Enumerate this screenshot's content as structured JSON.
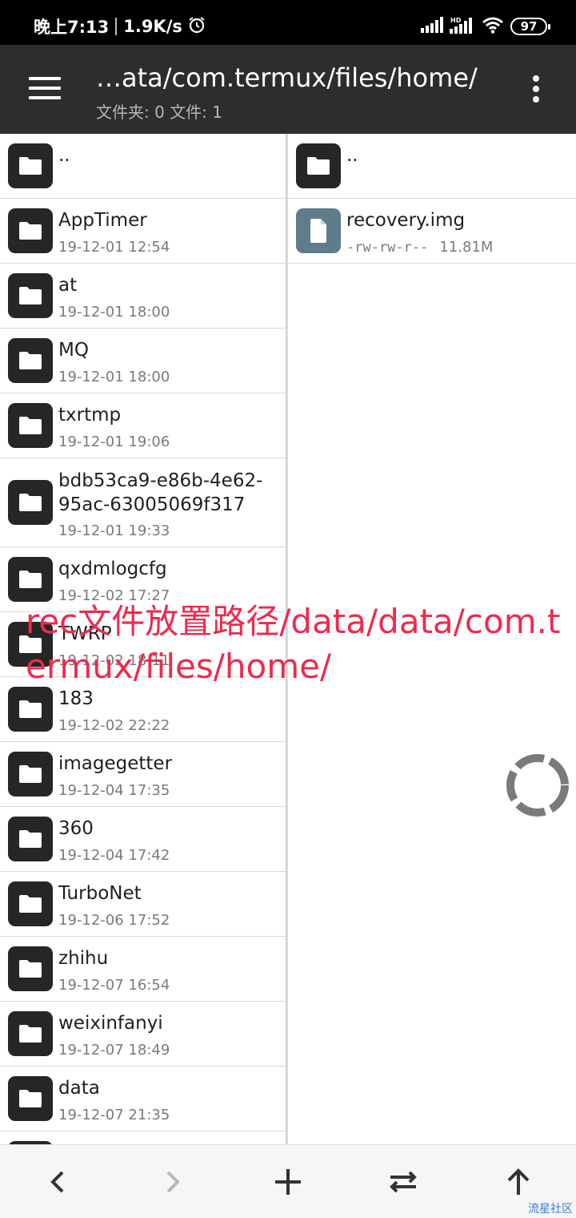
{
  "status_bar": {
    "time": "晚上7:13",
    "net_speed": "1.9K/s",
    "battery": "97",
    "icons": [
      "alarm-icon",
      "signal-icon",
      "signal-hd-icon",
      "wifi-icon",
      "battery-icon"
    ]
  },
  "toolbar": {
    "path_title": "…ata/com.termux/files/home/",
    "counts": "文件夹: 0  文件: 1"
  },
  "left_pane": {
    "items": [
      {
        "name": "..",
        "date": ""
      },
      {
        "name": "AppTimer",
        "date": "19-12-01 12:54"
      },
      {
        "name": "at",
        "date": "19-12-01 18:00"
      },
      {
        "name": "MQ",
        "date": "19-12-01 18:00"
      },
      {
        "name": "txrtmp",
        "date": "19-12-01 19:06"
      },
      {
        "name": "bdb53ca9-e86b-4e62-95ac-63005069f317",
        "date": "19-12-01 19:33"
      },
      {
        "name": "qxdmlogcfg",
        "date": "19-12-02 17:27"
      },
      {
        "name": "TWRP",
        "date": "19-12-02 18:11"
      },
      {
        "name": "183",
        "date": "19-12-02 22:22"
      },
      {
        "name": "imagegetter",
        "date": "19-12-04 17:35"
      },
      {
        "name": "360",
        "date": "19-12-04 17:42"
      },
      {
        "name": "TurboNet",
        "date": "19-12-06 17:52"
      },
      {
        "name": "zhihu",
        "date": "19-12-07 16:54"
      },
      {
        "name": "weixinfanyi",
        "date": "19-12-07 18:49"
      },
      {
        "name": "data",
        "date": "19-12-07 21:35"
      }
    ]
  },
  "right_pane": {
    "items": [
      {
        "name": "..",
        "type": "folder"
      },
      {
        "name": "recovery.img",
        "permissions": "-rw-rw-r--",
        "size": "11.81M",
        "type": "file"
      }
    ]
  },
  "overlay_annotation": "rec文件放置路径/data/data/com.termux/files/home/",
  "watermark": "流星社区",
  "bottom_bar": {
    "buttons": [
      "back-icon",
      "forward-icon",
      "add-icon",
      "swap-icon",
      "up-icon"
    ]
  }
}
